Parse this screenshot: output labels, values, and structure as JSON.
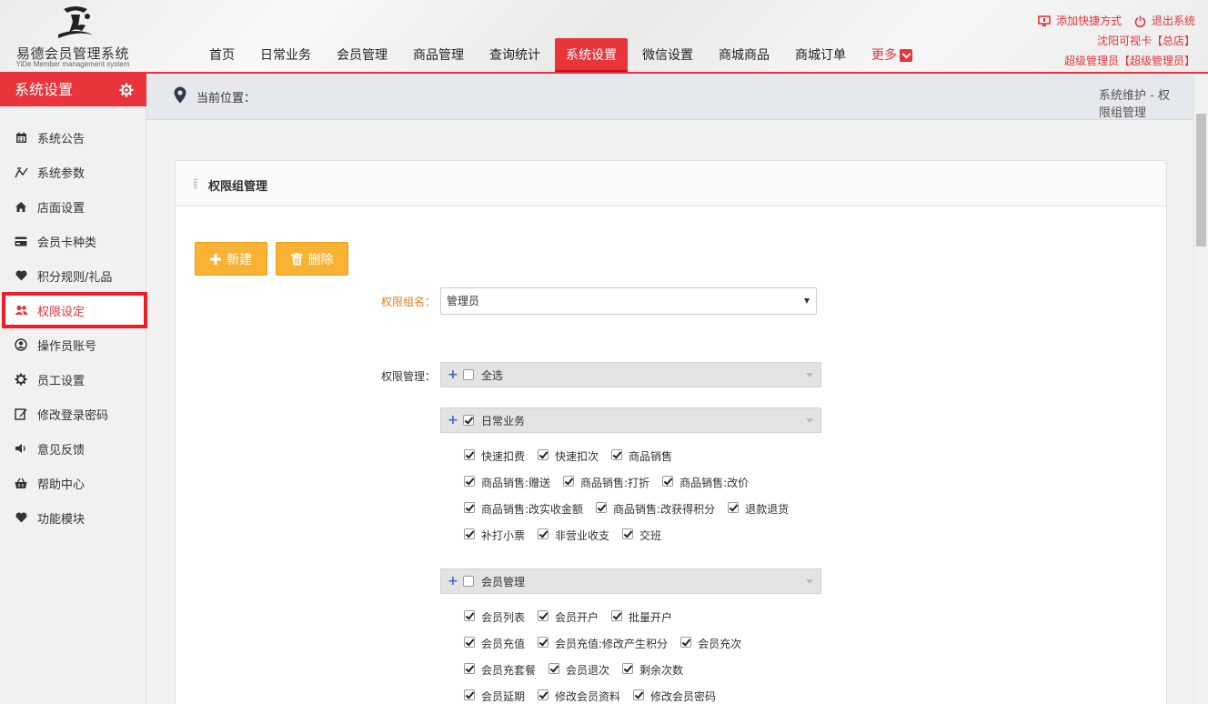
{
  "app": {
    "name": "易德会员管理系统",
    "subtitle": "YiDe Member management system"
  },
  "nav": {
    "items": [
      "首页",
      "日常业务",
      "会员管理",
      "商品管理",
      "查询统计",
      "系统设置",
      "微信设置",
      "商城商品",
      "商城订单"
    ],
    "active": "系统设置",
    "more_label": "更多"
  },
  "top_right": {
    "add_shortcut": "添加快捷方式",
    "logout": "退出系统",
    "store": "沈阳可视卡【总店】",
    "user": "超级管理员【超级管理员】"
  },
  "sidebar": {
    "title": "系统设置",
    "items": [
      {
        "label": "系统公告",
        "icon": "calendar-icon"
      },
      {
        "label": "系统参数",
        "icon": "sliders-icon"
      },
      {
        "label": "店面设置",
        "icon": "home-icon"
      },
      {
        "label": "会员卡种类",
        "icon": "card-icon"
      },
      {
        "label": "积分规则/礼品",
        "icon": "heart-icon"
      },
      {
        "label": "权限设定",
        "icon": "users-icon"
      },
      {
        "label": "操作员账号",
        "icon": "user-circle-icon"
      },
      {
        "label": "员工设置",
        "icon": "gear-icon"
      },
      {
        "label": "修改登录密码",
        "icon": "edit-icon"
      },
      {
        "label": "意见反馈",
        "icon": "volume-icon"
      },
      {
        "label": "帮助中心",
        "icon": "basket-icon"
      },
      {
        "label": "功能模块",
        "icon": "heart-icon"
      }
    ],
    "active_index": 5
  },
  "breadcrumb": {
    "label": "当前位置：",
    "path": "系统维护 - 权限组管理"
  },
  "panel": {
    "title": "权限组管理",
    "new_button": "新建",
    "delete_button": "删除",
    "group_name_label": "权限组名：",
    "group_name_value": "管理员",
    "perm_label": "权限管理："
  },
  "permissions": {
    "select_all": {
      "label": "全选",
      "checked": false
    },
    "groups": [
      {
        "label": "日常业务",
        "checked": true,
        "rows": [
          [
            "快速扣费",
            "快速扣次",
            "商品销售"
          ],
          [
            "商品销售:赠送",
            "商品销售:打折",
            "商品销售:改价"
          ],
          [
            "商品销售:改实收金额",
            "商品销售:改获得积分",
            "退款退货"
          ],
          [
            "补打小票",
            "非营业收支",
            "交班"
          ]
        ]
      },
      {
        "label": "会员管理",
        "checked": false,
        "rows": [
          [
            "会员列表",
            "会员开户",
            "批量开户"
          ],
          [
            "会员充值",
            "会员充值:修改产生积分",
            "会员充次"
          ],
          [
            "会员充套餐",
            "会员退次",
            "剩余次数"
          ],
          [
            "会员延期",
            "修改会员资料",
            "修改会员密码"
          ]
        ]
      }
    ]
  },
  "colors": {
    "accent": "#e8343a",
    "button": "#f8b334",
    "label_orange": "#e67e22"
  }
}
